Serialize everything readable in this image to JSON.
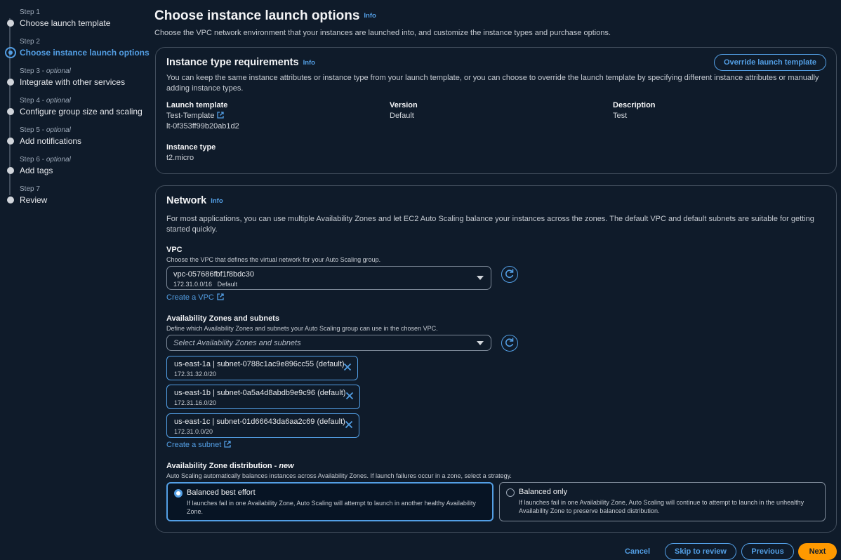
{
  "steps": [
    {
      "num": "Step 1",
      "optional": "",
      "label": "Choose launch template",
      "state": "done"
    },
    {
      "num": "Step 2",
      "optional": "",
      "label": "Choose instance launch options",
      "state": "active"
    },
    {
      "num": "Step 3",
      "optional": "optional",
      "label": "Integrate with other services",
      "state": "todo"
    },
    {
      "num": "Step 4",
      "optional": "optional",
      "label": "Configure group size and scaling",
      "state": "todo"
    },
    {
      "num": "Step 5",
      "optional": "optional",
      "label": "Add notifications",
      "state": "todo"
    },
    {
      "num": "Step 6",
      "optional": "optional",
      "label": "Add tags",
      "state": "todo"
    },
    {
      "num": "Step 7",
      "optional": "",
      "label": "Review",
      "state": "todo"
    }
  ],
  "page": {
    "title": "Choose instance launch options",
    "info": "Info",
    "description": "Choose the VPC network environment that your instances are launched into, and customize the instance types and purchase options."
  },
  "instance_card": {
    "title": "Instance type requirements",
    "info": "Info",
    "override_button": "Override launch template",
    "description": "You can keep the same instance attributes or instance type from your launch template, or you can choose to override the launch template by specifying different instance attributes or manually adding instance types.",
    "launch_template_label": "Launch template",
    "launch_template_name": "Test-Template",
    "launch_template_id": "lt-0f353ff99b20ab1d2",
    "version_label": "Version",
    "version_value": "Default",
    "description_label": "Description",
    "description_value": "Test",
    "instance_type_label": "Instance type",
    "instance_type_value": "t2.micro"
  },
  "network_card": {
    "title": "Network",
    "info": "Info",
    "description": "For most applications, you can use multiple Availability Zones and let EC2 Auto Scaling balance your instances across the zones. The default VPC and default subnets are suitable for getting started quickly.",
    "vpc_label": "VPC",
    "vpc_hint": "Choose the VPC that defines the virtual network for your Auto Scaling group.",
    "vpc_selected": "vpc-057686fbf1f8bdc30",
    "vpc_cidr": "172.31.0.0/16",
    "vpc_tag": "Default",
    "create_vpc": "Create a VPC",
    "az_label": "Availability Zones and subnets",
    "az_hint": "Define which Availability Zones and subnets your Auto Scaling group can use in the chosen VPC.",
    "az_placeholder": "Select Availability Zones and subnets",
    "subnets": [
      {
        "name": "us-east-1a | subnet-0788c1ac9e896cc55 (default)",
        "cidr": "172.31.32.0/20"
      },
      {
        "name": "us-east-1b | subnet-0a5a4d8abdb9e9c96 (default)",
        "cidr": "172.31.16.0/20"
      },
      {
        "name": "us-east-1c | subnet-01d66643da6aa2c69 (default)",
        "cidr": "172.31.0.0/20"
      }
    ],
    "create_subnet": "Create a subnet",
    "dist_label": "Availability Zone distribution - ",
    "dist_label_new": "new",
    "dist_hint": "Auto Scaling automatically balances instances across Availability Zones. If launch failures occur in a zone, select a strategy.",
    "options": [
      {
        "title": "Balanced best effort",
        "desc": "If launches fail in one Availability Zone, Auto Scaling will attempt to launch in another healthy Availability Zone.",
        "selected": true
      },
      {
        "title": "Balanced only",
        "desc": "If launches fail in one Availability Zone, Auto Scaling will continue to attempt to launch in the unhealthy Availability Zone to preserve balanced distribution.",
        "selected": false
      }
    ]
  },
  "footer": {
    "cancel": "Cancel",
    "skip": "Skip to review",
    "previous": "Previous",
    "next": "Next"
  },
  "colors": {
    "accent": "#539fe5",
    "primary_button": "#ff9900",
    "background": "#0f1b2a"
  }
}
